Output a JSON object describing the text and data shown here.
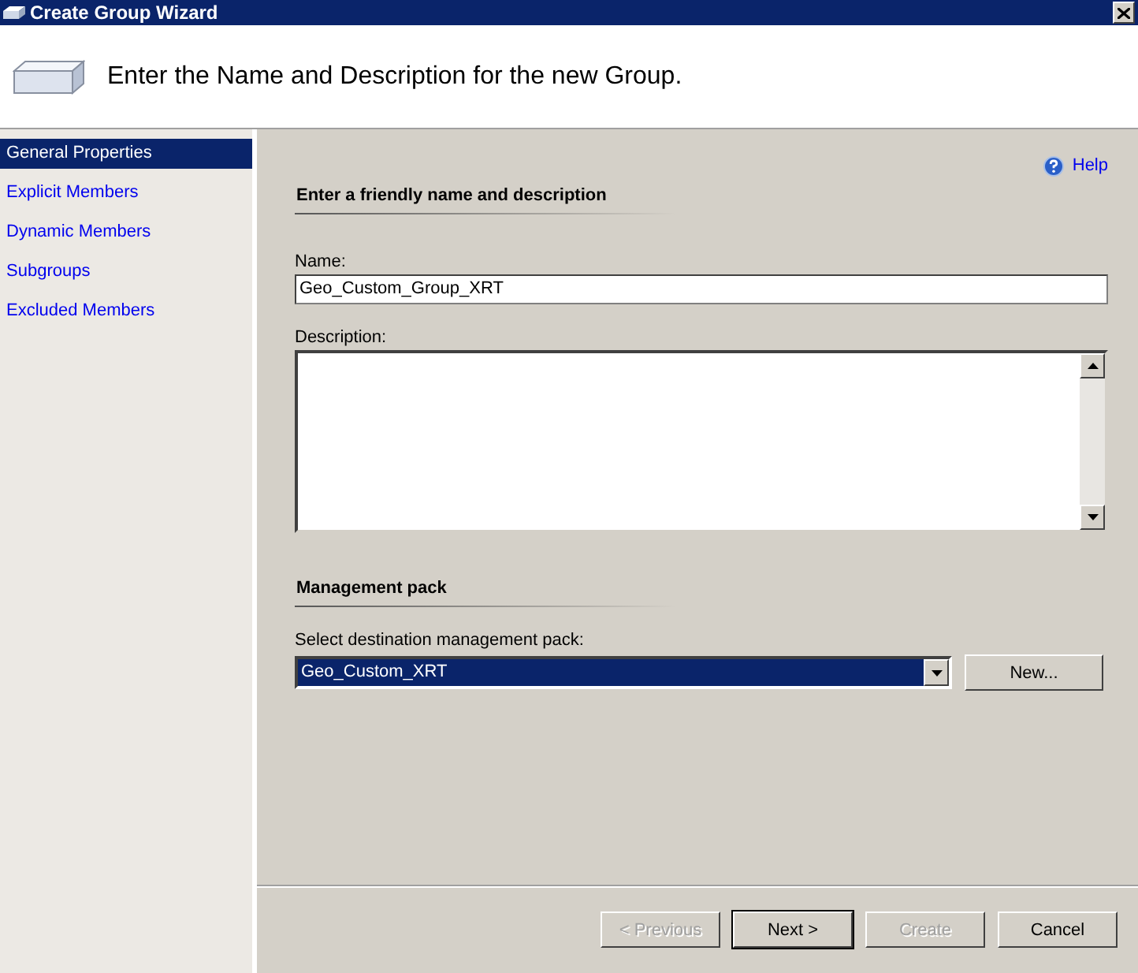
{
  "window": {
    "title": "Create Group Wizard",
    "header": "Enter the Name and Description for the new Group."
  },
  "sidebar": {
    "items": [
      {
        "label": "General Properties",
        "selected": true
      },
      {
        "label": "Explicit Members",
        "selected": false
      },
      {
        "label": "Dynamic Members",
        "selected": false
      },
      {
        "label": "Subgroups",
        "selected": false
      },
      {
        "label": "Excluded Members",
        "selected": false
      }
    ]
  },
  "help": "Help",
  "sections": [
    {
      "heading": "Enter a friendly name and description"
    },
    {
      "heading": "Management pack"
    }
  ],
  "name_field": {
    "label": "Name:",
    "value": "Geo_Custom_Group_XRT"
  },
  "description_field": {
    "label": "Description:"
  },
  "management_pack": {
    "label": "Select destination management pack:",
    "value": "Geo_Custom_XRT",
    "new_button": "New..."
  },
  "buttons": [
    {
      "label": "< Previous",
      "disabled": true,
      "default": false
    },
    {
      "label": "Next >",
      "disabled": false,
      "default": true
    },
    {
      "label": "Create",
      "disabled": true,
      "default": false
    },
    {
      "label": "Cancel",
      "disabled": false,
      "default": false
    }
  ]
}
